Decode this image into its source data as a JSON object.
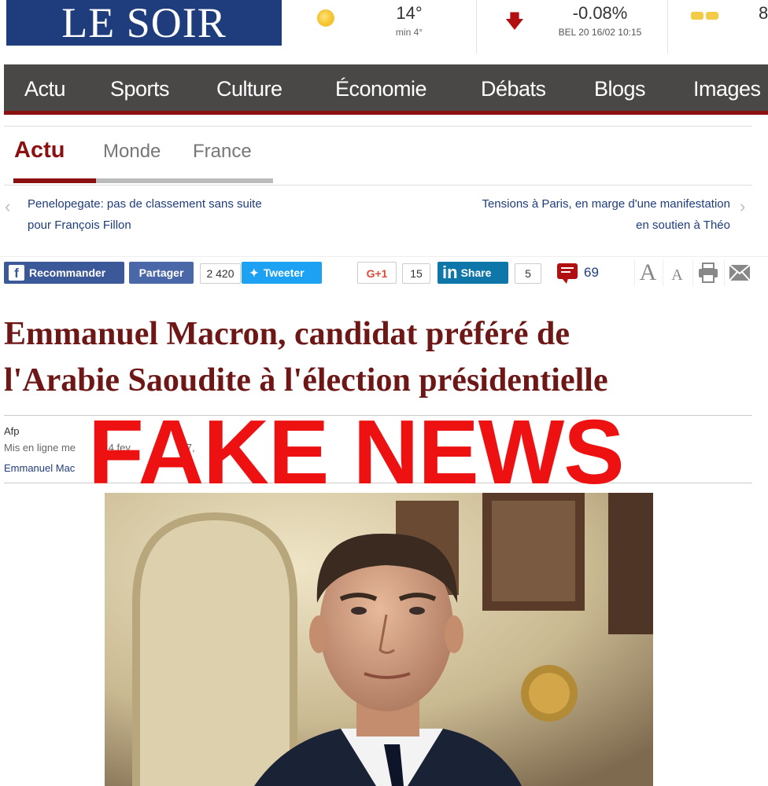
{
  "header": {
    "logo": "LE SOIR",
    "weather": {
      "icon": "sun-icon",
      "temperature": "14°",
      "min": "min 4°"
    },
    "bourse": {
      "icon": "arrow-down-icon",
      "change": "-0.08%",
      "info": "BEL 20 16/02 10:15"
    },
    "traffic": {
      "icon": "traffic-cars-icon",
      "value": "8"
    }
  },
  "nav": {
    "items": [
      {
        "label": "Actu"
      },
      {
        "label": "Sports"
      },
      {
        "label": "Culture"
      },
      {
        "label": "Économie"
      },
      {
        "label": "Débats"
      },
      {
        "label": "Blogs"
      },
      {
        "label": "Images"
      }
    ]
  },
  "section": {
    "tabs": [
      {
        "label": "Actu",
        "active": true
      },
      {
        "label": "Monde"
      },
      {
        "label": "France"
      }
    ]
  },
  "related": {
    "prev": {
      "line1": "Penelopegate: pas de classement sans suite",
      "line2": "pour François Fillon"
    },
    "next": {
      "line1": "Tensions à Paris, en marge d'une manifestation",
      "line2": "en soutien à Théo"
    }
  },
  "share": {
    "facebook_recommend": "Recommander",
    "facebook_share": "Partager",
    "facebook_count": "2 420",
    "tweet": "Tweeter",
    "gplus": "G+1",
    "gplus_count": "15",
    "linkedin": "Share",
    "linkedin_count": "5",
    "comments_count": "69",
    "font_larger": "A",
    "font_smaller": "A",
    "colors": {
      "facebook": "#3b5998",
      "twitter": "#1da1f2",
      "linkedin": "#0e76a8",
      "accent": "#8b1010"
    }
  },
  "article": {
    "headline_line1": "Emmanuel Macron, candidat préféré de",
    "headline_line2": "l'Arabie Saoudite à l'élection présidentielle",
    "author": "Afp",
    "published": "Mis en ligne me",
    "published_tail": "4 f",
    "published_tail2": "ev",
    "published_year": "17,",
    "tags": "Emmanuel Mac"
  },
  "overlay": {
    "stamp": "FAKE NEWS",
    "color": "#ee1111"
  },
  "photo": {
    "alt": "portrait-photo"
  }
}
